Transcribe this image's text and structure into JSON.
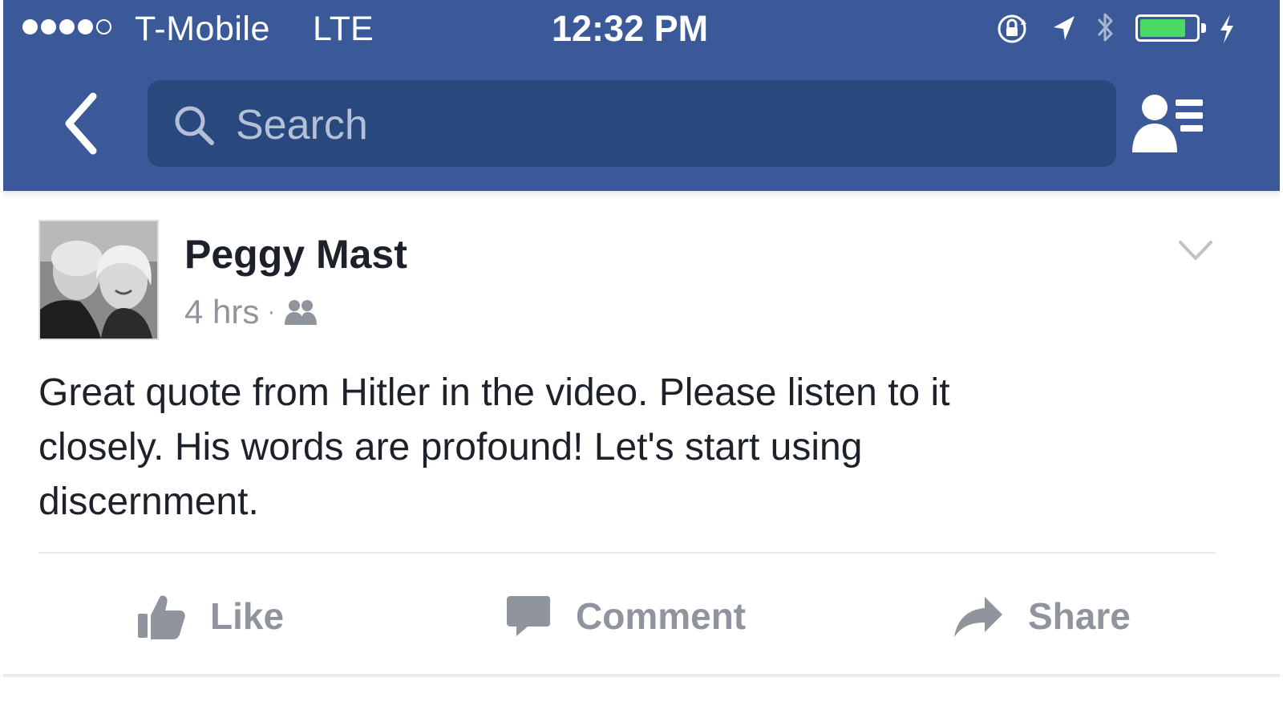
{
  "status_bar": {
    "signal_bars_filled": 4,
    "signal_bars_total": 5,
    "carrier": "T-Mobile",
    "network": "LTE",
    "time": "12:32 PM",
    "battery_level": 0.82,
    "icons": [
      "orientation-lock-icon",
      "location-arrow-icon",
      "bluetooth-icon",
      "battery-icon",
      "charging-bolt-icon"
    ]
  },
  "nav": {
    "back_icon": "chevron-left-icon",
    "search": {
      "placeholder": "Search"
    },
    "friends_icon": "friend-requests-icon"
  },
  "post": {
    "author": "Peggy Mast",
    "time": "4 hrs",
    "separator": "·",
    "audience_icon": "friends-icon",
    "text": "Great quote from Hitler in the video.  Please listen to it\nclosely.  His words are profound!  Let's start using\ndiscernment.",
    "actions": {
      "like": "Like",
      "comment": "Comment",
      "share": "Share"
    }
  },
  "colors": {
    "header_blue": "#3b5998",
    "search_field_blue": "#29487d",
    "text_dark": "#1d2129",
    "text_muted": "#90949c",
    "battery_green": "#4cd964"
  }
}
